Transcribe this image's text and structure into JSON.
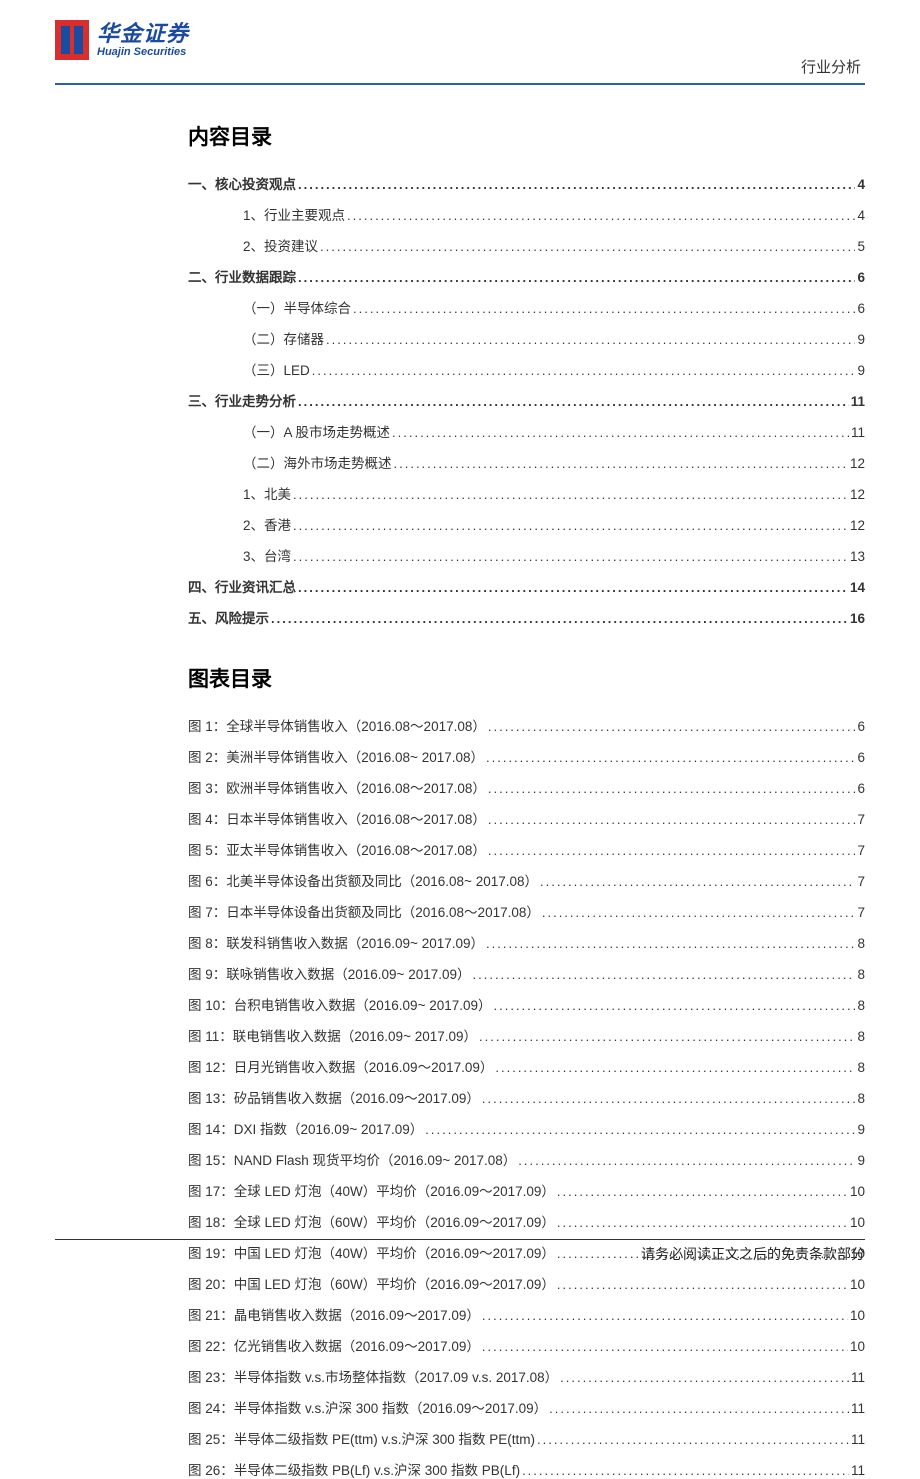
{
  "header": {
    "logo_cn": "华金证券",
    "logo_en": "Huajin Securities",
    "tag": "行业分析"
  },
  "toc_title": "内容目录",
  "toc": [
    {
      "label": "一、核心投资观点",
      "page": "4",
      "level": 0,
      "bold": true
    },
    {
      "label": "1、行业主要观点 ",
      "page": "4",
      "level": 2,
      "bold": false
    },
    {
      "label": "2、投资建议 ",
      "page": "5",
      "level": 2,
      "bold": false
    },
    {
      "label": "二、行业数据跟踪",
      "page": "6",
      "level": 0,
      "bold": true
    },
    {
      "label": "（一）半导体综合",
      "page": "6",
      "level": 1,
      "bold": false
    },
    {
      "label": "（二）存储器",
      "page": "9",
      "level": 1,
      "bold": false
    },
    {
      "label": "（三）LED",
      "page": "9",
      "level": 1,
      "bold": false
    },
    {
      "label": "三、行业走势分析",
      "page": " 11",
      "level": 0,
      "bold": true
    },
    {
      "label": "（一）A 股市场走势概述 ",
      "page": " 11",
      "level": 1,
      "bold": false
    },
    {
      "label": "（二）海外市场走势概述",
      "page": "12",
      "level": 1,
      "bold": false
    },
    {
      "label": "1、北美 ",
      "page": "12",
      "level": 2,
      "bold": false
    },
    {
      "label": "2、香港 ",
      "page": "12",
      "level": 2,
      "bold": false
    },
    {
      "label": "3、台湾 ",
      "page": "13",
      "level": 2,
      "bold": false
    },
    {
      "label": "四、行业资讯汇总",
      "page": "14",
      "level": 0,
      "bold": true
    },
    {
      "label": "五、风险提示",
      "page": "16",
      "level": 0,
      "bold": true
    }
  ],
  "fig_title": "图表目录",
  "figs": [
    {
      "label": "图 1：全球半导体销售收入（2016.08～2017.08） ",
      "page": "6"
    },
    {
      "label": "图 2：美洲半导体销售收入（2016.08~ 2017.08） ",
      "page": "6"
    },
    {
      "label": "图 3：欧洲半导体销售收入（2016.08～2017.08） ",
      "page": "6"
    },
    {
      "label": "图 4：日本半导体销售收入（2016.08～2017.08） ",
      "page": "7"
    },
    {
      "label": "图 5：亚太半导体销售收入（2016.08～2017.08） ",
      "page": "7"
    },
    {
      "label": "图 6：北美半导体设备出货额及同比（2016.08~ 2017.08） ",
      "page": "7"
    },
    {
      "label": "图 7：日本半导体设备出货额及同比（2016.08～2017.08） ",
      "page": "7"
    },
    {
      "label": "图 8：联发科销售收入数据（2016.09~ 2017.09） ",
      "page": "8"
    },
    {
      "label": "图 9：联咏销售收入数据（2016.09~ 2017.09） ",
      "page": "8"
    },
    {
      "label": "图 10：台积电销售收入数据（2016.09~ 2017.09） ",
      "page": "8"
    },
    {
      "label": "图 11：联电销售收入数据（2016.09~ 2017.09） ",
      "page": "8"
    },
    {
      "label": "图 12：日月光销售收入数据（2016.09～2017.09） ",
      "page": "8"
    },
    {
      "label": "图 13：矽品销售收入数据（2016.09～2017.09） ",
      "page": "8"
    },
    {
      "label": "图 14：DXI 指数（2016.09~ 2017.09） ",
      "page": "9"
    },
    {
      "label": "图 15：NAND Flash 现货平均价（2016.09~ 2017.08） ",
      "page": "9"
    },
    {
      "label": "图 17：全球 LED 灯泡（40W）平均价（2016.09～2017.09） ",
      "page": "10"
    },
    {
      "label": "图 18：全球 LED 灯泡（60W）平均价（2016.09～2017.09） ",
      "page": "10"
    },
    {
      "label": "图 19：中国 LED 灯泡（40W）平均价（2016.09～2017.09） ",
      "page": "10"
    },
    {
      "label": "图 20：中国 LED 灯泡（60W）平均价（2016.09～2017.09） ",
      "page": "10"
    },
    {
      "label": "图 21：晶电销售收入数据（2016.09～2017.09） ",
      "page": "10"
    },
    {
      "label": "图 22：亿光销售收入数据（2016.09～2017.09） ",
      "page": "10"
    },
    {
      "label": "图 23：半导体指数 v.s.市场整体指数（2017.09 v.s. 2017.08） ",
      "page": " 11"
    },
    {
      "label": "图 24：半导体指数 v.s.沪深 300 指数（2016.09～2017.09） ",
      "page": " 11"
    },
    {
      "label": "图 25：半导体二级指数 PE(ttm) v.s.沪深 300 指数 PE(ttm)",
      "page": " 11"
    },
    {
      "label": "图 26：半导体二级指数 PB(Lf) v.s.沪深 300 指数 PB(Lf)",
      "page": " 11"
    }
  ],
  "footer": "请务必阅读正文之后的免责条款部分"
}
